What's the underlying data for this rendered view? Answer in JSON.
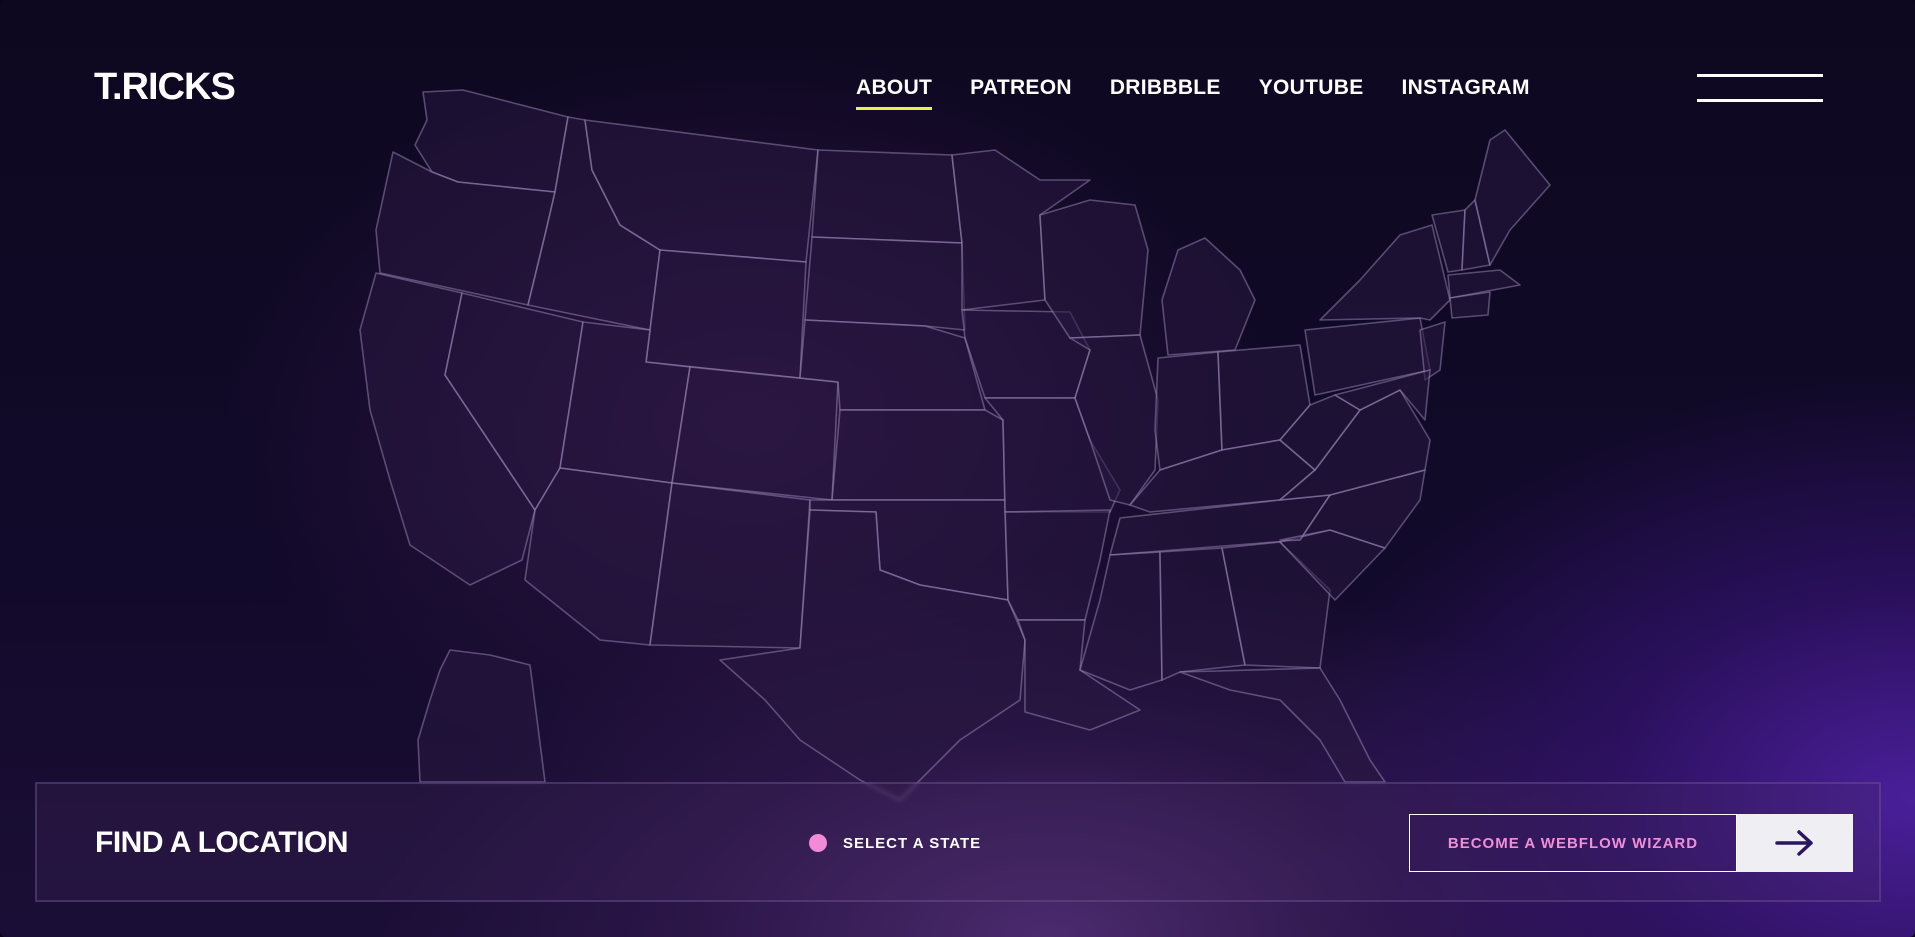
{
  "brand": {
    "logo": "T.RICKS"
  },
  "nav": {
    "items": [
      {
        "label": "ABOUT",
        "active": true
      },
      {
        "label": "PATREON",
        "active": false
      },
      {
        "label": "DRIBBBLE",
        "active": false
      },
      {
        "label": "YOUTUBE",
        "active": false
      },
      {
        "label": "INSTAGRAM",
        "active": false
      }
    ],
    "active_underline_color": "#e6f25a",
    "menu_icon": "hamburger-icon"
  },
  "map": {
    "description_icon": "usa-states-map"
  },
  "location_bar": {
    "title": "FIND A LOCATION",
    "select_label": "SELECT A STATE",
    "select_dot_color": "#f28ad7",
    "cta_label": "BECOME A WEBFLOW WIZARD",
    "cta_color": "#f08fd6",
    "cta_icon": "arrow-right-icon"
  },
  "colors": {
    "background": "#0d0820",
    "accent_purple": "#4a1f9a"
  }
}
